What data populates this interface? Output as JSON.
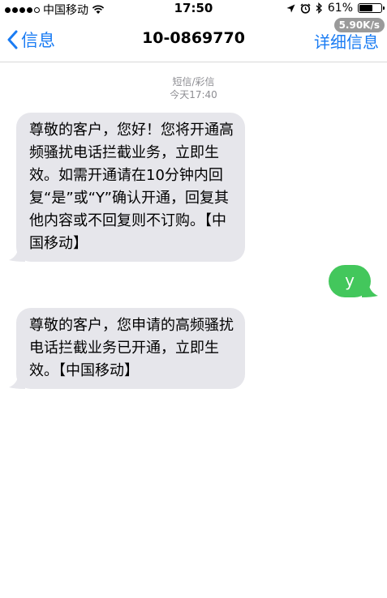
{
  "status_bar": {
    "carrier": "中国移动",
    "time": "17:50",
    "battery": "61%",
    "battery_level": 0.61,
    "network_speed": "5.90K/s"
  },
  "nav": {
    "back_label": "信息",
    "title": "10-0869770",
    "details_label": "详细信息"
  },
  "thread": {
    "service_type": "短信/彩信",
    "timestamp": "今天17:40"
  },
  "messages": [
    {
      "direction": "incoming",
      "lines": [
        "尊敬的客户，您好！您将开通高",
        "频骚扰电话拦截业务，立即生",
        "效。如需开通请在10分钟内回",
        "复“是”或“Y”确认开通，回复其",
        "他内容或不回复则不订购。【中",
        "国移动】"
      ]
    },
    {
      "direction": "outgoing",
      "lines": [
        "y"
      ]
    },
    {
      "direction": "incoming",
      "lines": [
        "尊敬的客户，您申请的高频骚扰",
        "电话拦截业务已开通，立即生",
        "效。【中国移动】"
      ]
    }
  ],
  "colors": {
    "accent": "#1a7cf3",
    "incoming_bubble": "#e6e6eb",
    "outgoing_bubble": "#43c75c"
  }
}
